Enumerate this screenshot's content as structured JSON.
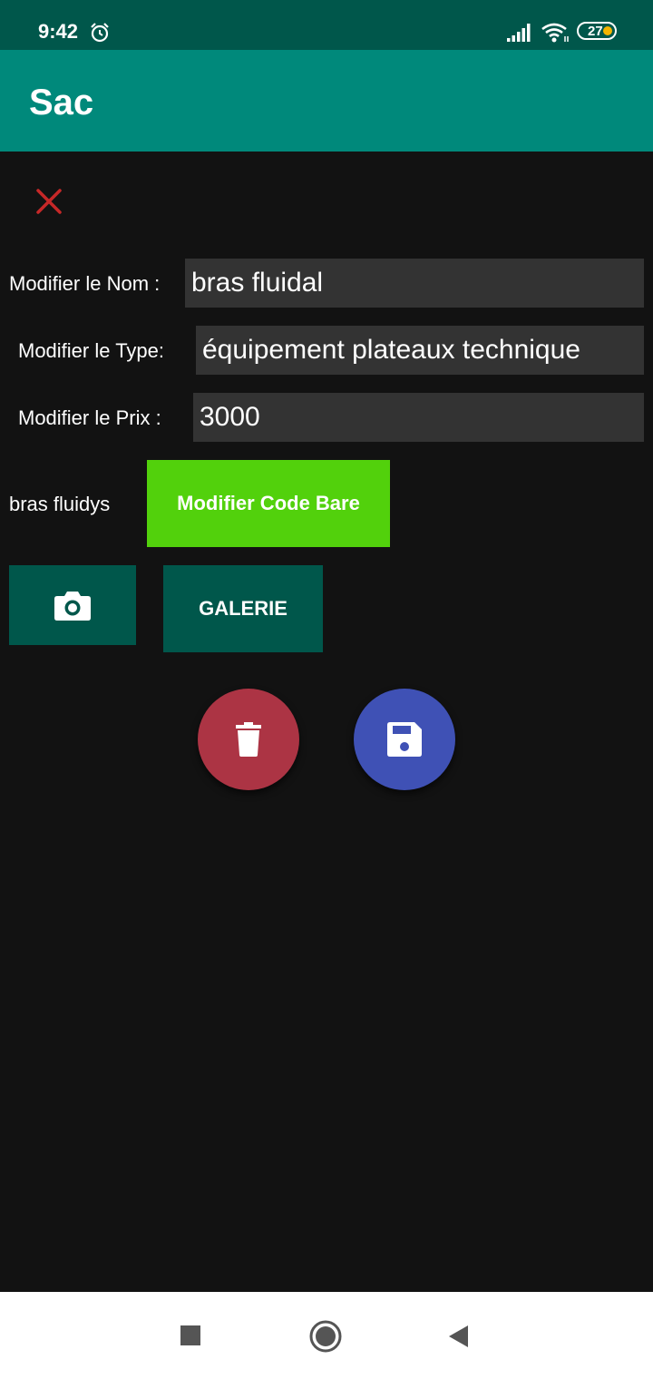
{
  "status_bar": {
    "time": "9:42",
    "battery": "27",
    "icons": [
      "alarm-icon",
      "signal-icon",
      "wifi-icon",
      "battery-icon"
    ]
  },
  "app_bar": {
    "title": "Sac"
  },
  "form": {
    "close_icon": "close-icon",
    "name_label": "Modifier le Nom :",
    "name_value": "bras fluidal",
    "type_label": "Modifier le Type:",
    "type_value": "équipement plateaux technique",
    "price_label": "Modifier le Prix :",
    "price_value": "3000",
    "barcode_value": "bras fluidys",
    "barcode_button": "Modifier Code Bare",
    "camera_icon": "camera-icon",
    "gallery_button": "GALERIE"
  },
  "actions": {
    "delete_icon": "trash-icon",
    "save_icon": "save-icon"
  },
  "nav_bar": {
    "icons": [
      "recents-icon",
      "home-icon",
      "back-icon"
    ]
  },
  "colors": {
    "status_bar": "#00574b",
    "app_bar": "#00897b",
    "background": "#121212",
    "field_bg": "#333333",
    "barcode_button": "#52d10c",
    "dark_teal_button": "#00574b",
    "delete_fab": "#ac3444",
    "save_fab": "#3f51b5",
    "close_icon": "#c62828"
  }
}
